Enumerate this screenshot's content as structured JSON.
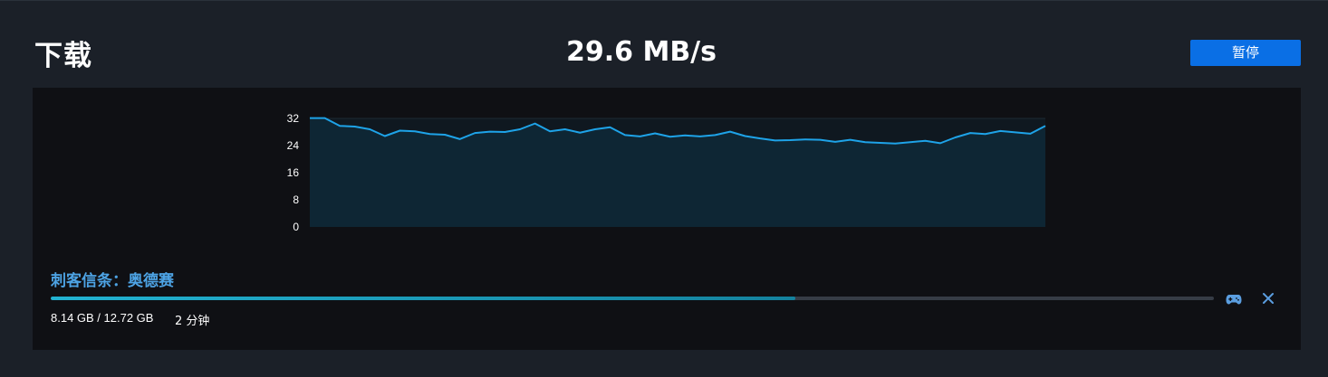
{
  "header": {
    "title": "下载",
    "speed": "29.6 MB/s",
    "pause_label": "暂停"
  },
  "download": {
    "game_title": "刺客信条：奥德赛",
    "size_text": "8.14 GB / 12.72 GB",
    "time_remaining": "2 分钟",
    "progress": 0.64,
    "progress_colors": [
      "#22b3d2",
      "#14829e"
    ]
  },
  "actions": {
    "gamepad_icon": "gamepad-icon",
    "close_icon": "close-icon"
  },
  "colors": {
    "accent": "#0a6fe5",
    "line": "#1ea3e8",
    "title_blue": "#4da3e4"
  },
  "chart_data": {
    "type": "area",
    "title": "",
    "xlabel": "",
    "ylabel": "",
    "ylim": [
      0,
      32
    ],
    "yticks": [
      0,
      8,
      16,
      24,
      32
    ],
    "grid": true,
    "series": [
      {
        "values": [
          32.1,
          32.1,
          29.8,
          29.6,
          28.8,
          26.8,
          28.4,
          28.2,
          27.4,
          27.2,
          25.9,
          27.7,
          28.1,
          28.0,
          28.8,
          30.5,
          28.2,
          28.8,
          27.8,
          28.8,
          29.4,
          27.1,
          26.7,
          27.6,
          26.6,
          27.0,
          26.7,
          27.1,
          28.1,
          26.8,
          26.1,
          25.5,
          25.6,
          25.8,
          25.7,
          25.1,
          25.7,
          25.0,
          24.8,
          24.6,
          25.0,
          25.4,
          24.7,
          26.4,
          27.7,
          27.4,
          28.3,
          27.9,
          27.5,
          29.8
        ]
      }
    ]
  }
}
